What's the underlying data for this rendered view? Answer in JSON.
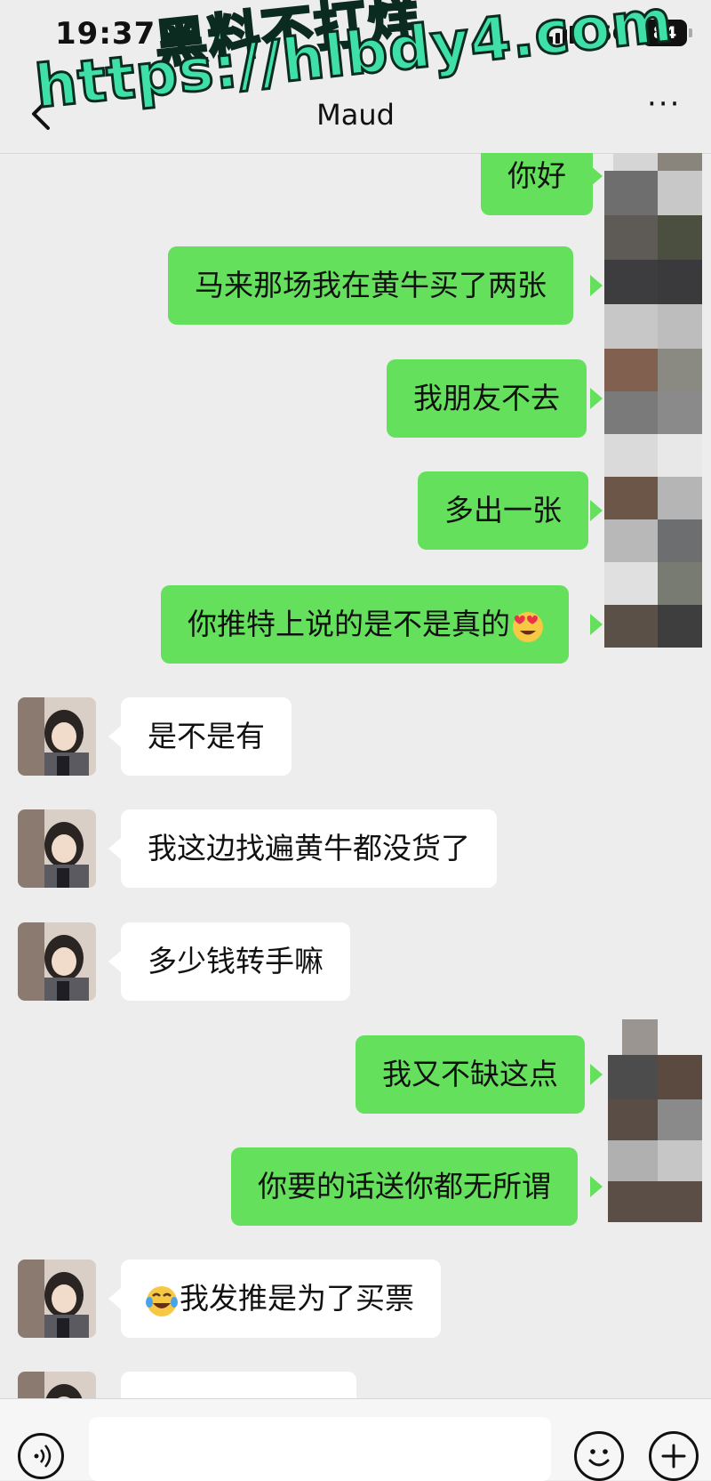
{
  "status_bar": {
    "time": "19:37",
    "network": "5G",
    "battery": "84"
  },
  "nav": {
    "title": "Maud",
    "more": "···"
  },
  "watermark": {
    "line1": "黑料不打烊",
    "line2": "https://hlbdy4.com"
  },
  "messages": [
    {
      "side": "me",
      "text": "你好"
    },
    {
      "side": "me",
      "text": "马来那场我在黄牛买了两张"
    },
    {
      "side": "me",
      "text": "我朋友不去"
    },
    {
      "side": "me",
      "text": "多出一张"
    },
    {
      "side": "me",
      "text": "你推特上说的是不是真的",
      "emoji": "heart-eyes-emoji"
    },
    {
      "side": "them",
      "text": "是不是有"
    },
    {
      "side": "them",
      "text": "我这边找遍黄牛都没货了"
    },
    {
      "side": "them",
      "text": "多少钱转手嘛"
    },
    {
      "side": "me",
      "text": "我又不缺这点"
    },
    {
      "side": "me",
      "text": "你要的话送你都无所谓"
    },
    {
      "side": "them",
      "text": "我发推是为了买票",
      "emoji": "tears-of-joy-emoji"
    }
  ],
  "colors": {
    "my_bubble": "#64e05c",
    "their_bubble": "#ffffff",
    "background": "#ededed",
    "watermark": "#3ee0a8"
  }
}
